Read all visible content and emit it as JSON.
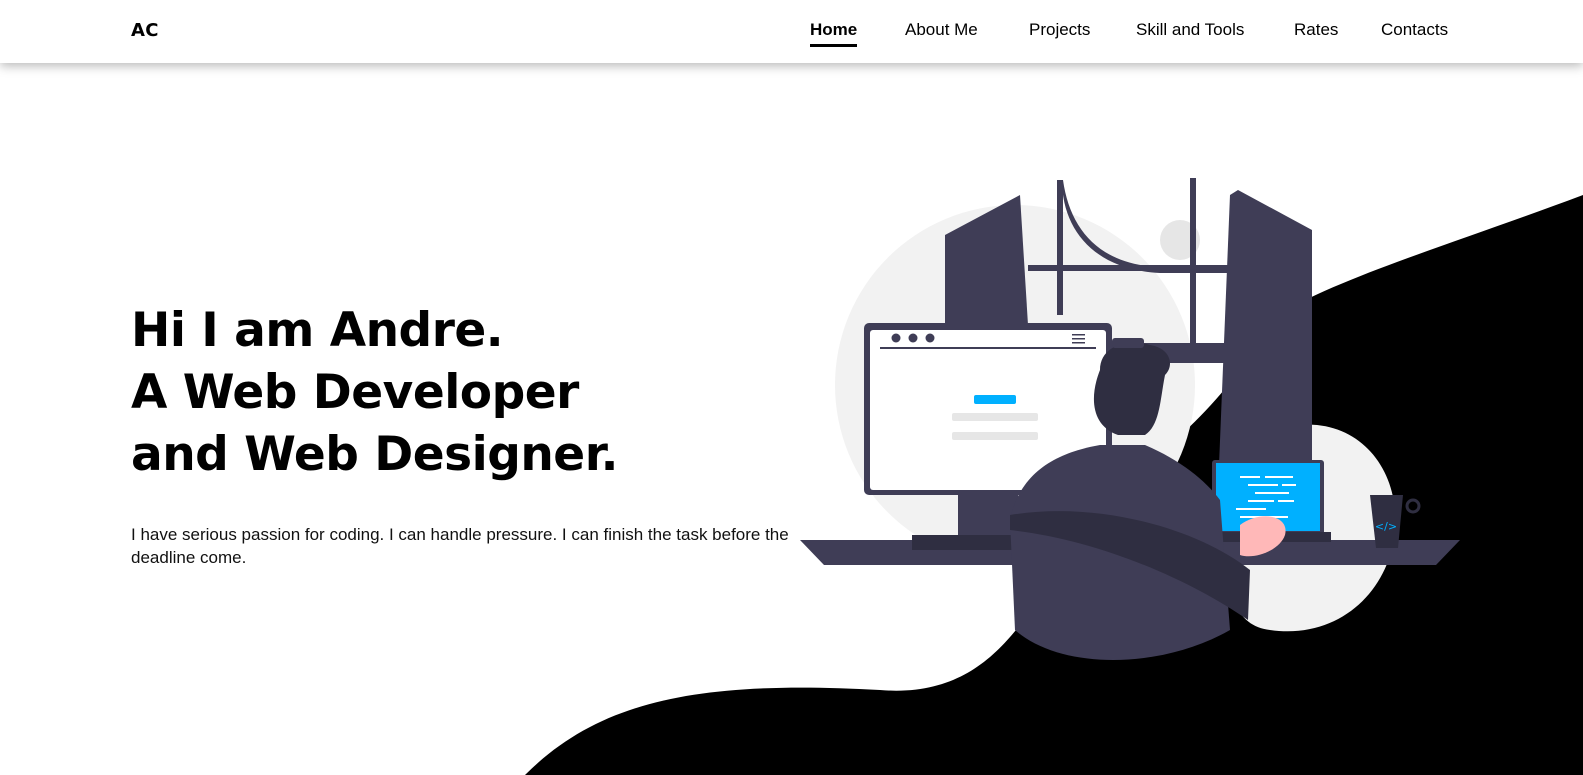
{
  "brand": {
    "logo_text": "AC"
  },
  "nav": {
    "items": [
      {
        "label": "Home",
        "active": true
      },
      {
        "label": "About Me",
        "active": false
      },
      {
        "label": "Projects",
        "active": false
      },
      {
        "label": "Skill and Tools",
        "active": false
      },
      {
        "label": "Rates",
        "active": false
      },
      {
        "label": "Contacts",
        "active": false
      }
    ]
  },
  "hero": {
    "title_lines": [
      "Hi I am Andre.",
      "A Web Developer",
      "and Web Designer."
    ],
    "description": "I have serious passion for coding. I can handle pressure. I can finish the task before the deadline come."
  },
  "colors": {
    "background": "#ffffff",
    "blob": "#000000",
    "illustration_dark": "#3f3d56",
    "illustration_accent": "#00b0ff",
    "illustration_light": "#f2f2f2",
    "skin": "#ffb8b8"
  },
  "icons": [
    "hero-illustration",
    "code-icon"
  ]
}
